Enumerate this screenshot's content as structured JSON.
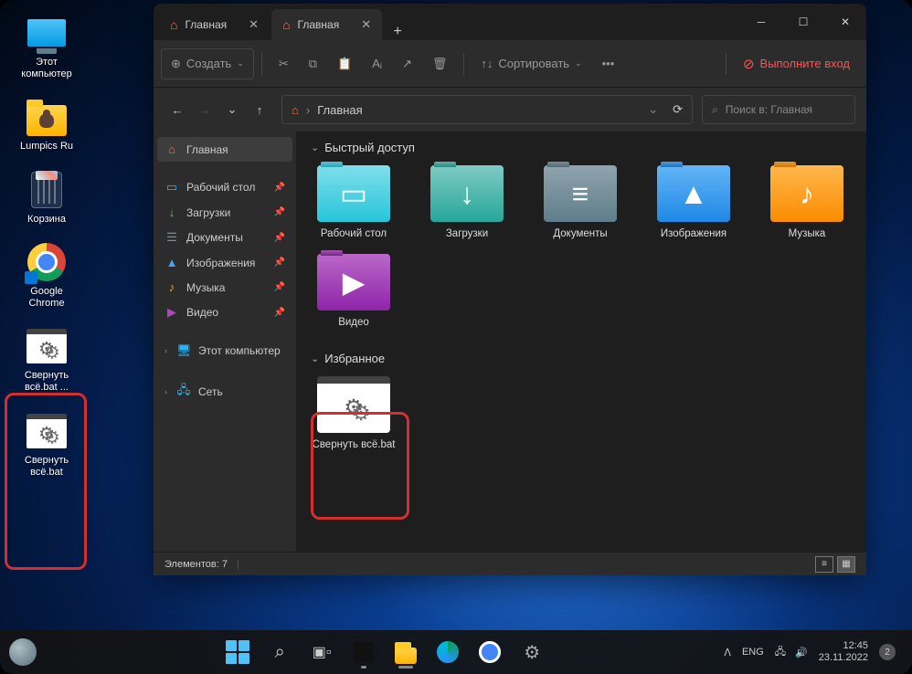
{
  "desktop": {
    "icons": [
      {
        "label": "Этот\nкомпьютер"
      },
      {
        "label": "Lumpics Ru"
      },
      {
        "label": "Корзина"
      },
      {
        "label": "Google\nChrome"
      },
      {
        "label": "Свернуть\nвсё.bat ..."
      },
      {
        "label": "Свернуть\nвсё.bat"
      }
    ]
  },
  "explorer": {
    "tabs": [
      {
        "label": "Главная",
        "active": false
      },
      {
        "label": "Главная",
        "active": true
      }
    ],
    "toolbar": {
      "create": "Создать",
      "sort": "Сортировать",
      "login": "Выполните вход"
    },
    "address": {
      "crumb": "Главная",
      "sep": "›"
    },
    "search_placeholder": "Поиск в: Главная",
    "sidebar": {
      "home": "Главная",
      "items": [
        {
          "label": "Рабочий стол",
          "color": "#29b6f6"
        },
        {
          "label": "Загрузки",
          "color": "#66bb6a"
        },
        {
          "label": "Документы",
          "color": "#78909c"
        },
        {
          "label": "Изображения",
          "color": "#42a5f5"
        },
        {
          "label": "Музыка",
          "color": "#ffa726"
        },
        {
          "label": "Видео",
          "color": "#ab47bc"
        }
      ],
      "pc": "Этот компьютер",
      "net": "Сеть"
    },
    "sections": {
      "quick": "Быстрый доступ",
      "fav": "Избранное"
    },
    "quick_items": [
      {
        "label": "Рабочий стол",
        "cls": "desk",
        "glyph": "▭"
      },
      {
        "label": "Загрузки",
        "cls": "dl",
        "glyph": "↓"
      },
      {
        "label": "Документы",
        "cls": "doc",
        "glyph": "≡"
      },
      {
        "label": "Изображения",
        "cls": "img",
        "glyph": "▲"
      },
      {
        "label": "Музыка",
        "cls": "mus",
        "glyph": "♪"
      },
      {
        "label": "Видео",
        "cls": "vid",
        "glyph": "▶"
      }
    ],
    "fav_items": [
      {
        "label": "Свернуть всё.bat",
        "cls": "bat"
      }
    ],
    "status": "Элементов: 7"
  },
  "taskbar": {
    "lang": "ENG",
    "time": "12:45",
    "date": "23.11.2022",
    "notif": "2",
    "chev": "ᐱ"
  }
}
